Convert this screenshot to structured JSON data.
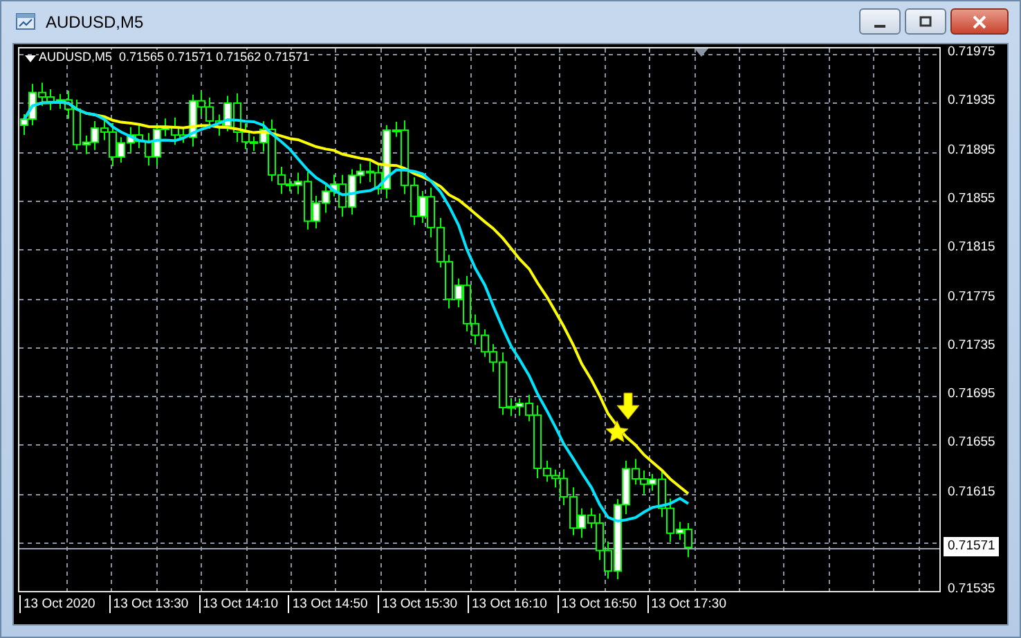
{
  "window": {
    "title": "AUDUSD,M5"
  },
  "chart": {
    "info": "AUDUSD,M5  0.71565 0.71571 0.71562 0.71571",
    "price_axis": [
      "0.71975",
      "0.71935",
      "0.71895",
      "0.71855",
      "0.71815",
      "0.71775",
      "0.71735",
      "0.71695",
      "0.71655",
      "0.71615",
      "0.71535"
    ],
    "current_price": "0.71571",
    "time_axis": [
      "13 Oct 2020",
      "13 Oct 13:30",
      "13 Oct 14:10",
      "13 Oct 14:50",
      "13 Oct 15:30",
      "13 Oct 16:10",
      "13 Oct 16:50",
      "13 Oct 17:30"
    ]
  }
}
